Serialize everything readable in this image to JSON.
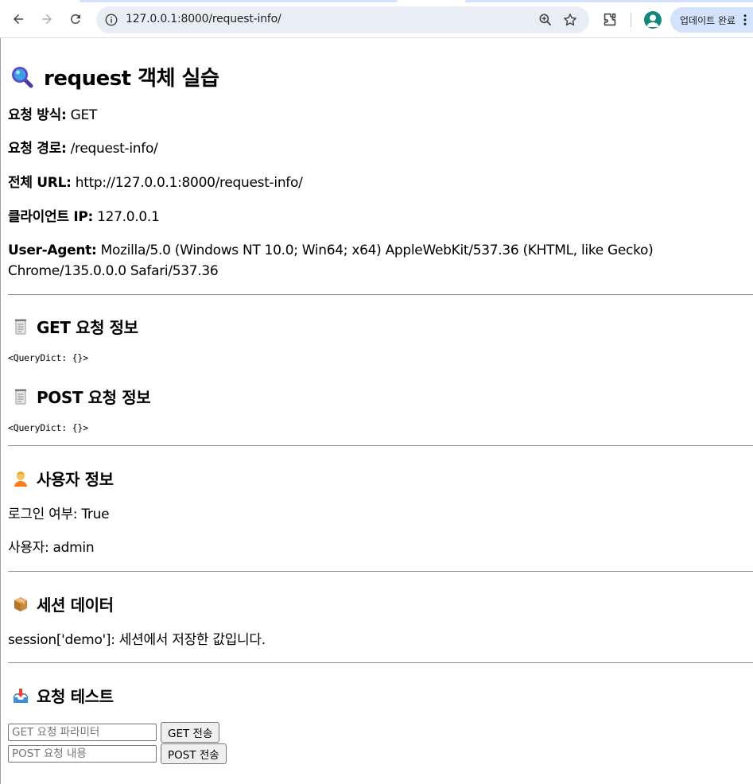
{
  "browser": {
    "url": "127.0.0.1:8000/request-info/",
    "update_label": "업데이트 완료",
    "accent": "#d3e3fd",
    "omnibox_bg": "#e9eef6"
  },
  "page": {
    "title": "request 객체 실습",
    "request": [
      {
        "label": "요청 방식:",
        "value": " GET"
      },
      {
        "label": "요청 경로:",
        "value": " /request-info/"
      },
      {
        "label": "전체 URL:",
        "value": " http://127.0.0.1:8000/request-info/"
      },
      {
        "label": "클라이언트 IP:",
        "value": " 127.0.0.1"
      },
      {
        "label": "User-Agent:",
        "value": " Mozilla/5.0 (Windows NT 10.0; Win64; x64) AppleWebKit/537.36 (KHTML, like Gecko) Chrome/135.0.0.0 Safari/537.36"
      }
    ],
    "get_section": {
      "heading": "GET 요청 정보",
      "value": "<QueryDict: {}>"
    },
    "post_section": {
      "heading": "POST 요청 정보",
      "value": "<QueryDict: {}>"
    },
    "user_section": {
      "heading": "사용자 정보",
      "login_status": "로그인 여부: True",
      "username": "사용자: admin"
    },
    "session_section": {
      "heading": "세션 데이터",
      "entry": "session['demo']: 세션에서 저장한 값입니다."
    },
    "test_section": {
      "heading": "요청 테스트",
      "get_placeholder": "GET 요청 파라미터",
      "get_button": "GET 전송",
      "post_placeholder": "POST 요청 내용",
      "post_button": "POST 전송"
    }
  }
}
